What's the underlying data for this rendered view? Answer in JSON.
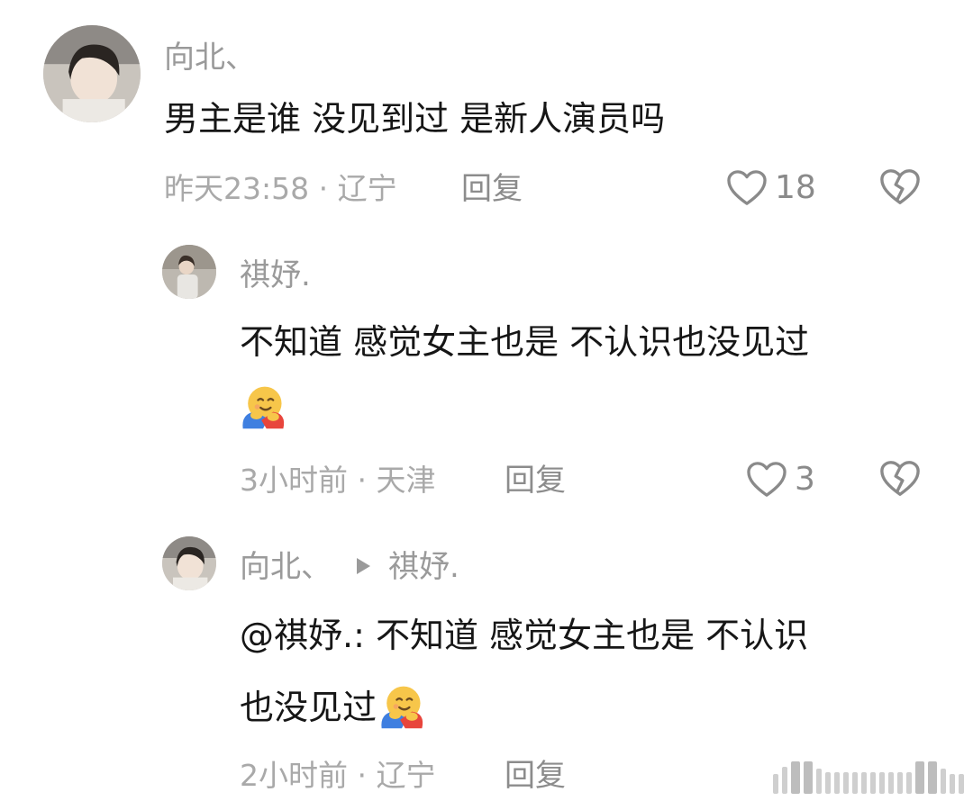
{
  "comments": [
    {
      "user": "向北、",
      "text": "男主是谁 没见到过 是新人演员吗",
      "time_location": "昨天23:58 · 辽宁",
      "reply_label": "回复",
      "likes": "18"
    },
    {
      "user": "祺妤.",
      "text_line1": "不知道 感觉女主也是 不认识也没见过",
      "emoji": "hugging-face-emoji",
      "time_location": "3小时前 · 天津",
      "reply_label": "回复",
      "likes": "3"
    },
    {
      "user": "向北、",
      "reply_to": "祺妤.",
      "text_line1": "@祺妤.: 不知道 感觉女主也是 不认识",
      "text_line2": "也没见过",
      "emoji": "hugging-face-emoji",
      "time_location": "2小时前 · 辽宁",
      "reply_label": "回复"
    }
  ],
  "icons": {
    "like": "heart-outline-icon",
    "dislike": "broken-heart-icon",
    "reply_arrow": "triangle-right-icon"
  },
  "colors": {
    "meta_text": "#a9a9a9",
    "username": "#9a9a9a",
    "body_text": "#161616"
  }
}
